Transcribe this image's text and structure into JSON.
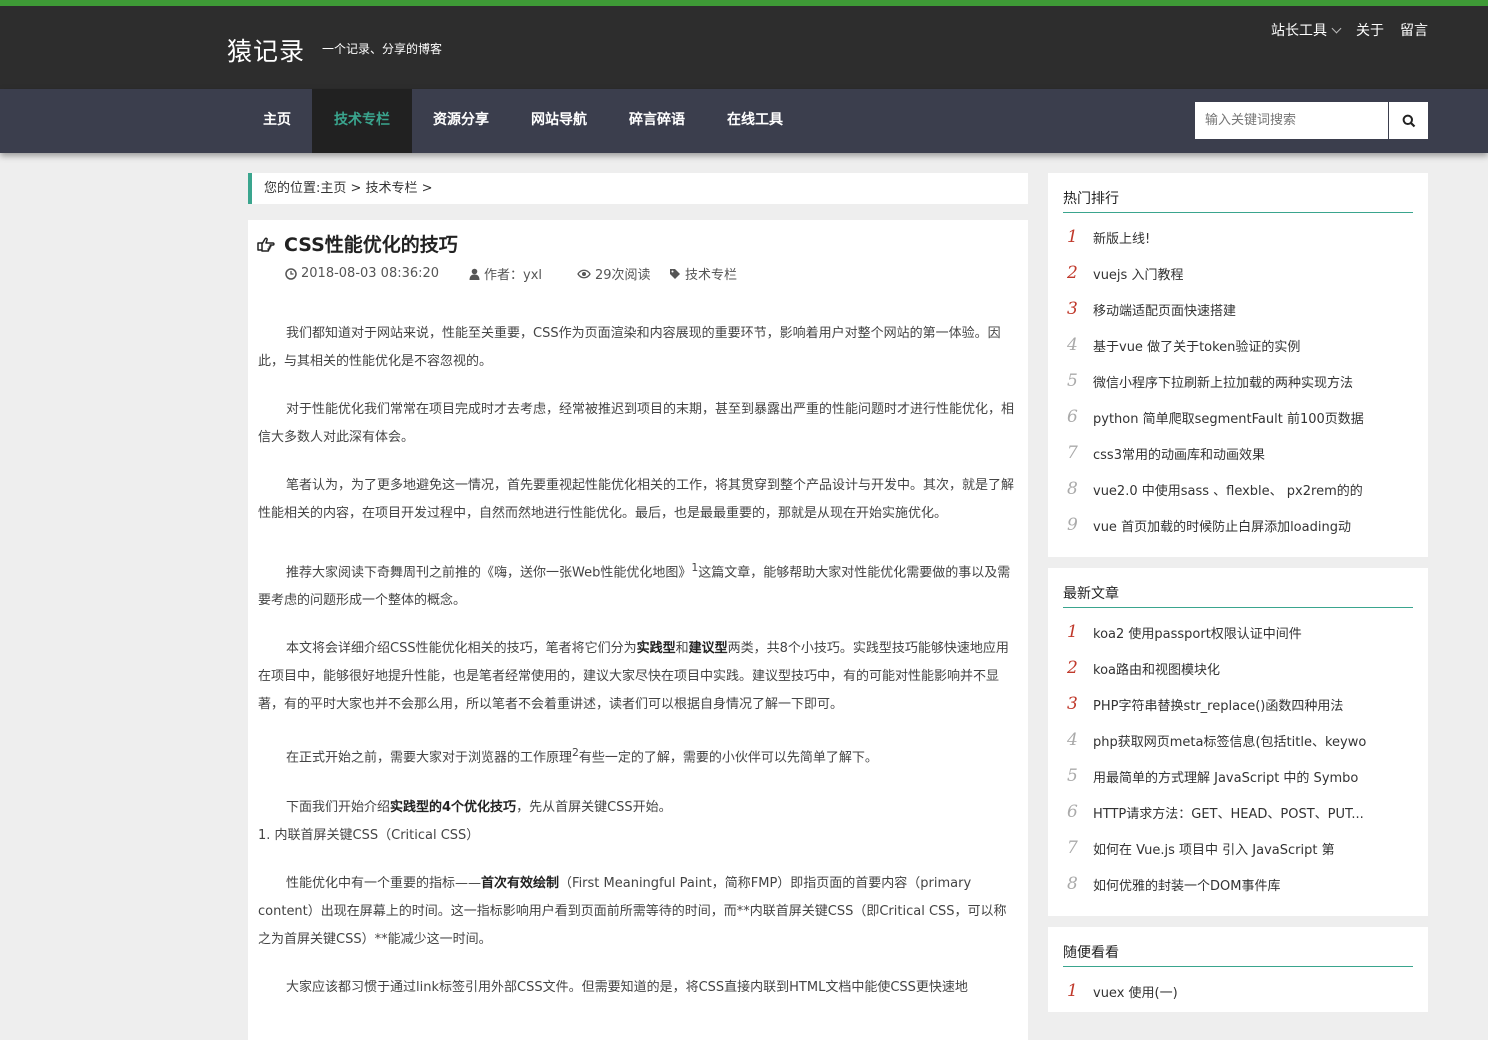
{
  "header": {
    "site_title": "猿记录",
    "site_subtitle": "一个记录、分享的博客",
    "top_links": {
      "tools": "站长工具",
      "about": "关于",
      "message": "留言"
    }
  },
  "nav": {
    "items": [
      {
        "label": "主页"
      },
      {
        "label": "技术专栏"
      },
      {
        "label": "资源分享"
      },
      {
        "label": "网站导航"
      },
      {
        "label": "碎言碎语"
      },
      {
        "label": "在线工具"
      }
    ],
    "active": "技术专栏",
    "search_placeholder": "输入关键词搜索"
  },
  "breadcrumb": "您的位置:主页 > 技术专栏 >",
  "article": {
    "title": "CSS性能优化的技巧",
    "date": "2018-08-03 08:36:20",
    "author": "作者：yxl",
    "views": "29次阅读",
    "category": "技术专栏",
    "p1": "我们都知道对于网站来说，性能至关重要，CSS作为页面渲染和内容展现的重要环节，影响着用户对整个网站的第一体验。因此，与其相关的性能优化是不容忽视的。",
    "p2": "对于性能优化我们常常在项目完成时才去考虑，经常被推迟到项目的末期，甚至到暴露出严重的性能问题时才进行性能优化，相信大多数人对此深有体会。",
    "p3": "笔者认为，为了更多地避免这一情况，首先要重视起性能优化相关的工作，将其贯穿到整个产品设计与开发中。其次，就是了解性能相关的内容，在项目开发过程中，自然而然地进行性能优化。最后，也是最最重要的，那就是从现在开始实施优化。",
    "p4a": "推荐大家阅读下奇舞周刊之前推的《嗨，送你一张Web性能优化地图》",
    "p4sup": "1",
    "p4b": "这篇文章，能够帮助大家对性能优化需要做的事以及需要考虑的问题形成一个整体的概念。",
    "p5a": "本文将会详细介绍CSS性能优化相关的技巧，笔者将它们分为",
    "p5b1": "实践型",
    "p5c": "和",
    "p5b2": "建议型",
    "p5d": "两类，共8个小技巧。实践型技巧能够快速地应用在项目中，能够很好地提升性能，也是笔者经常使用的，建议大家尽快在项目中实践。建议型技巧中，有的可能对性能影响并不显著，有的平时大家也并不会那么用，所以笔者不会着重讲述，读者们可以根据自身情况了解一下即可。",
    "p6a": "在正式开始之前，需要大家对于浏览器的工作原理",
    "p6sup": "2",
    "p6b": "有些一定的了解，需要的小伙伴可以先简单了解下。",
    "p7a": "下面我们开始介绍",
    "p7b": "实践型的4个优化技巧",
    "p7c": "，先从首屏关键CSS开始。",
    "p8": "1. 内联首屏关键CSS（Critical CSS）",
    "p9a": "性能优化中有一个重要的指标——",
    "p9b": "首次有效绘制",
    "p9c": "（First Meaningful Paint，简称FMP）即指页面的首要内容（primary content）出现在屏幕上的时间。这一指标影响用户看到页面前所需等待的时间，而**内联首屏关键CSS（即Critical CSS，可以称之为首屏关键CSS）**能减少这一时间。",
    "p10": "大家应该都习惯于通过link标签引用外部CSS文件。但需要知道的是，将CSS直接内联到HTML文档中能使CSS更快速地"
  },
  "hot": {
    "title": "热门排行",
    "items": [
      {
        "num": "1",
        "text": "新版上线!"
      },
      {
        "num": "2",
        "text": "vuejs 入门教程"
      },
      {
        "num": "3",
        "text": "移动端适配页面快速搭建"
      },
      {
        "num": "4",
        "text": "基于vue 做了关于token验证的实例"
      },
      {
        "num": "5",
        "text": "微信小程序下拉刷新上拉加载的两种实现方法"
      },
      {
        "num": "6",
        "text": "python 简单爬取segmentFault 前100页数据"
      },
      {
        "num": "7",
        "text": "css3常用的动画库和动画效果"
      },
      {
        "num": "8",
        "text": "vue2.0 中使用sass 、flexble、 px2rem的的"
      },
      {
        "num": "9",
        "text": "vue 首页加载的时候防止白屏添加loading动"
      }
    ]
  },
  "latest": {
    "title": "最新文章",
    "items": [
      {
        "num": "1",
        "text": "koa2 使用passport权限认证中间件"
      },
      {
        "num": "2",
        "text": "koa路由和视图模块化"
      },
      {
        "num": "3",
        "text": "PHP字符串替换str_replace()函数四种用法"
      },
      {
        "num": "4",
        "text": "php获取网页meta标签信息(包括title、keywo"
      },
      {
        "num": "5",
        "text": "用最简单的方式理解 JavaScript 中的 Symbo"
      },
      {
        "num": "6",
        "text": "HTTP请求方法：GET、HEAD、POST、PUT..."
      },
      {
        "num": "7",
        "text": "如何在 Vue.js 项目中 引入 JavaScript 第"
      },
      {
        "num": "8",
        "text": "如何优雅的封装一个DOM事件库"
      }
    ]
  },
  "random": {
    "title": "随便看看",
    "items": [
      {
        "num": "1",
        "text": "vuex 使用(一)"
      }
    ]
  },
  "colors": {
    "accent": "#3aa58e",
    "top_bar": "#3e9a36",
    "rank_top": "#c0392b"
  }
}
